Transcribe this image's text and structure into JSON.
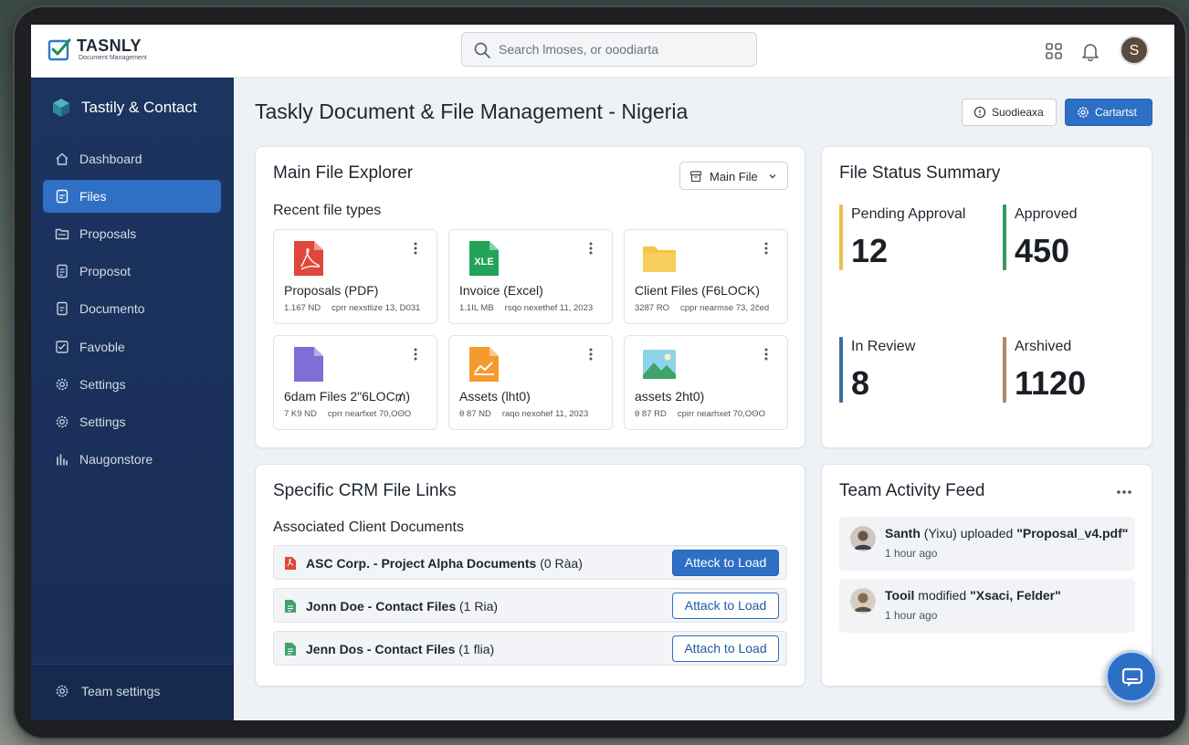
{
  "app": {
    "logo_title": "TASNLY",
    "logo_subtitle": "Document Management"
  },
  "search": {
    "placeholder": "Search lmoses, or ooodiarta"
  },
  "user": {
    "avatar_initial": "S"
  },
  "sidebar": {
    "brand": "Tastily & Contact",
    "items": [
      {
        "label": "Dashboard",
        "icon": "home-icon",
        "active": false
      },
      {
        "label": "Files",
        "icon": "file-icon",
        "active": true
      },
      {
        "label": "Proposals",
        "icon": "folder-icon",
        "active": false
      },
      {
        "label": "Proposot",
        "icon": "document-icon",
        "active": false
      },
      {
        "label": "Documento",
        "icon": "document-icon",
        "active": false
      },
      {
        "label": "Favoble",
        "icon": "checklist-icon",
        "active": false
      },
      {
        "label": "Settings",
        "icon": "gear-icon",
        "active": false
      },
      {
        "label": "Settings",
        "icon": "gear-icon",
        "active": false
      },
      {
        "label": "Naugonstore",
        "icon": "chart-icon",
        "active": false
      }
    ],
    "footer_label": "Team settings"
  },
  "header": {
    "title": "Taskly Document & File Management - Nigeria",
    "button_secondary": "Suodieaxa",
    "button_primary": "Cartartst"
  },
  "explorer": {
    "title": "Main File Explorer",
    "dropdown_value": "Main File",
    "subtitle": "Recent file types",
    "files": [
      {
        "name": "Proposals (PDF)",
        "size": "1.167 ND",
        "meta": "cprr nexstlize 13, D031",
        "icon": "pdf-icon",
        "color": "#e0463b"
      },
      {
        "name": "Invoice (Excel)",
        "size": "1.1IL MB",
        "meta": "rsqo nexethef 11, 2023",
        "icon": "excel-icon",
        "color": "#21a35a"
      },
      {
        "name": "Client Files (F6LOCK)",
        "size": "3287 RO",
        "meta": "cppr nearmse 73, 2čed",
        "icon": "folder-icon",
        "color": "#f6c343"
      },
      {
        "name": "6dam Files 2\"6LOC₥)",
        "size": "7 K9 ND",
        "meta": "cprr nearfxet 70,OΘO",
        "icon": "document-icon",
        "color": "#7d6fd6"
      },
      {
        "name": "Assets (lht0)",
        "size": "θ 87 ND",
        "meta": "raqo nexohef 11, 2023",
        "icon": "chart-file-icon",
        "color": "#f59a2e"
      },
      {
        "name": "assets 2ht0)",
        "size": "θ 87 RD",
        "meta": "cpirr nearhxet 70,OΘO",
        "icon": "image-icon",
        "color": "#3fa36a"
      }
    ]
  },
  "status": {
    "title": "File Status Summary",
    "items": [
      {
        "label": "Pending Approval",
        "value": "12",
        "color": "#e8c14b"
      },
      {
        "label": "Approved",
        "value": "450",
        "color": "#3a9a5b"
      },
      {
        "label": "In Review",
        "value": "8",
        "color": "#3c6d9e"
      },
      {
        "label": "Arshived",
        "value": "1120",
        "color": "#b08a62"
      }
    ]
  },
  "crm": {
    "title": "Specific CRM File Links",
    "subtitle": "Associated Client Documents",
    "rows": [
      {
        "name": "ASC Corp. - Project Alpha Documents",
        "count": "(0 Ràa)",
        "button": "Atteck to Load",
        "style": "solid",
        "icon": "pdf-icon",
        "color": "#e0463b"
      },
      {
        "name": "Jonn Doe - Contact Files",
        "count": "(1 Ria)",
        "button": "Attack to Load",
        "style": "outline",
        "icon": "sheet-icon",
        "color": "#3fa36a"
      },
      {
        "name": "Jenn Dos - Contact Files",
        "count": "(1 flia)",
        "button": "Attach to Load",
        "style": "outline",
        "icon": "sheet-icon",
        "color": "#3fa36a"
      }
    ]
  },
  "activity": {
    "title": "Team Activity Feed",
    "items": [
      {
        "user": "Santh",
        "detail": " (Yixu) uploaded ",
        "target": "\"Proposal_v4.pdf\"",
        "time": "1 hour ago"
      },
      {
        "user": "Tooil",
        "detail": " modified ",
        "target": "\"Xsaci, Felder\"",
        "time": "1 hour ago"
      }
    ]
  },
  "icons": {
    "grid": "apps-grid-icon",
    "bell": "bell-icon",
    "chat": "chat-icon"
  }
}
